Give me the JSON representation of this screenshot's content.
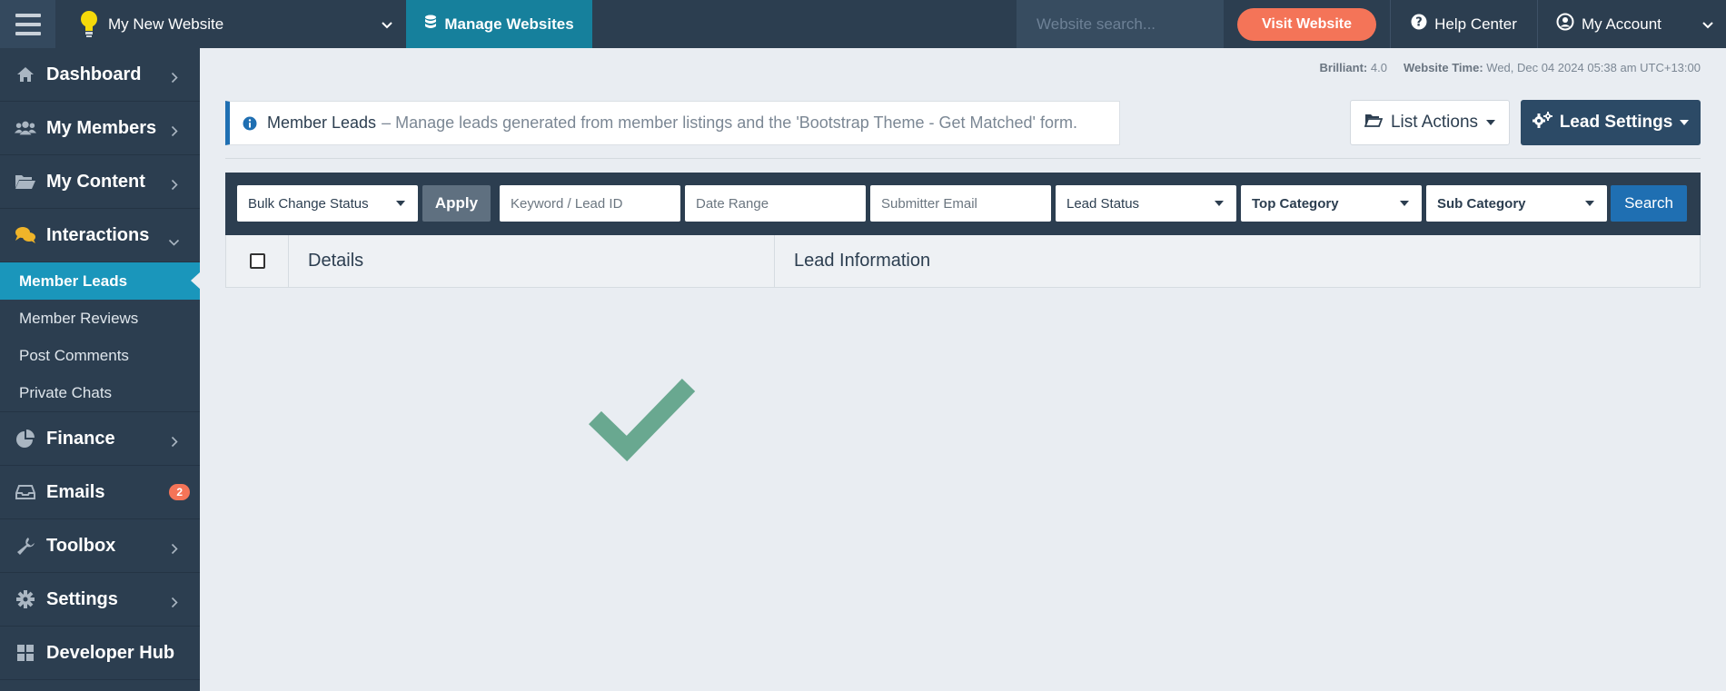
{
  "topbar": {
    "site_name": "My New Website",
    "manage_websites_label": "Manage Websites",
    "search_placeholder": "Website search...",
    "visit_website_label": "Visit Website",
    "help_center_label": "Help Center",
    "my_account_label": "My Account"
  },
  "sidebar": {
    "items": [
      {
        "label": "Dashboard",
        "icon": "home-icon"
      },
      {
        "label": "My Members",
        "icon": "users-icon"
      },
      {
        "label": "My Content",
        "icon": "folder-open-icon"
      },
      {
        "label": "Interactions",
        "icon": "comments-icon"
      },
      {
        "label": "Finance",
        "icon": "pie-chart-icon"
      },
      {
        "label": "Emails",
        "icon": "inbox-icon",
        "badge": "2"
      },
      {
        "label": "Toolbox",
        "icon": "wrench-icon"
      },
      {
        "label": "Settings",
        "icon": "gear-icon"
      },
      {
        "label": "Developer Hub",
        "icon": "grid-icon"
      }
    ],
    "interactions_sub": [
      {
        "label": "Member Leads",
        "active": true
      },
      {
        "label": "Member Reviews"
      },
      {
        "label": "Post Comments"
      },
      {
        "label": "Private Chats"
      }
    ]
  },
  "meta": {
    "version_label": "Brilliant:",
    "version_value": "4.0",
    "time_label": "Website Time:",
    "time_value": "Wed, Dec 04 2024 05:38 am UTC+13:00"
  },
  "page": {
    "title": "Member Leads",
    "description": "– Manage leads generated from member listings and the 'Bootstrap Theme - Get Matched' form.",
    "list_actions_label": "List Actions",
    "lead_settings_label": "Lead Settings"
  },
  "filters": {
    "bulk_status": "Bulk Change Status",
    "apply_label": "Apply",
    "keyword_placeholder": "Keyword / Lead ID",
    "date_placeholder": "Date Range",
    "email_placeholder": "Submitter Email",
    "lead_status": "Lead Status",
    "top_category": "Top Category",
    "sub_category": "Sub Category",
    "search_label": "Search"
  },
  "table": {
    "columns": [
      "Details",
      "Lead Information"
    ]
  },
  "colors": {
    "sidebar_bg": "#2c3e50",
    "accent_teal": "#16809c",
    "active_item": "#1a96bb",
    "visit_button": "#f47458",
    "primary_blue": "#1f6fb2",
    "checkmark": "#69a890"
  }
}
